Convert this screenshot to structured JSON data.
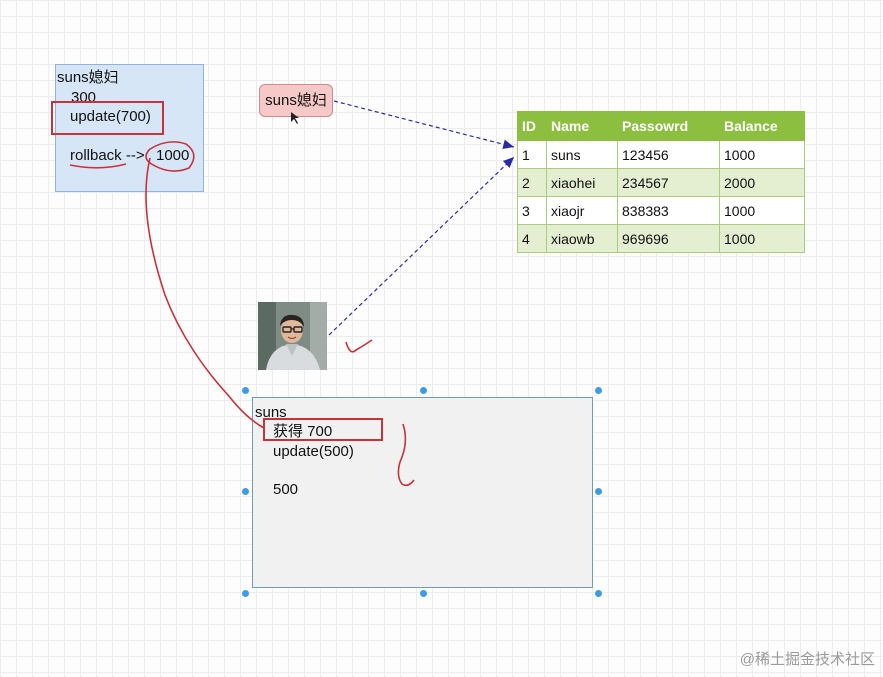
{
  "transaction_a": {
    "title": "suns媳妇",
    "balance": "300",
    "update": "update(700)",
    "rollback": "rollback -->",
    "result": "1000"
  },
  "requester_label": "suns媳妇",
  "accounts_table": {
    "columns": [
      "ID",
      "Name",
      "Passowrd",
      "Balance"
    ],
    "rows": [
      [
        "1",
        "suns",
        "123456",
        "1000"
      ],
      [
        "2",
        "xiaohei",
        "234567",
        "2000"
      ],
      [
        "3",
        "xiaojr",
        "838383",
        "1000"
      ],
      [
        "4",
        "xiaowb",
        "969696",
        "1000"
      ]
    ]
  },
  "transaction_b": {
    "title": "suns",
    "obtained": "获得 700",
    "update": "update(500)",
    "balance": "500"
  },
  "watermark": "@稀土掘金技术社区",
  "colors": {
    "table_header": "#8cbf3f",
    "annotation_red": "#c8323a",
    "arrow_blue": "#2a2aa8",
    "selection_handle": "#3d9ce6"
  }
}
